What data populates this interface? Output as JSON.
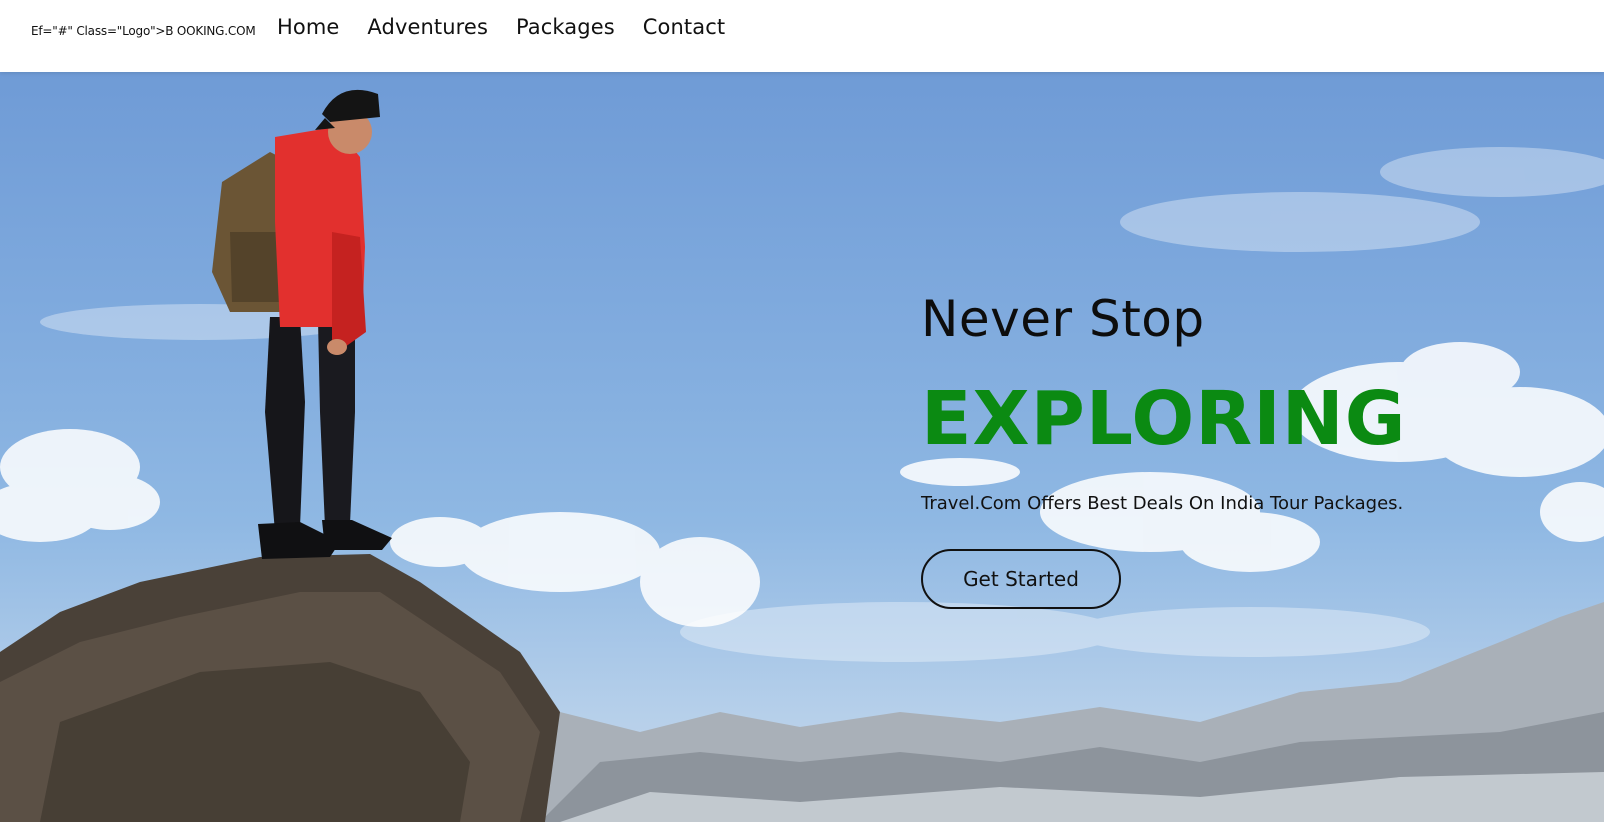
{
  "header": {
    "logo_text": "Ef=\"#\" Class=\"Logo\">B OOKING.COM",
    "nav": [
      {
        "label": "Home"
      },
      {
        "label": "Adventures"
      },
      {
        "label": "Packages"
      },
      {
        "label": "Contact"
      }
    ]
  },
  "hero": {
    "subtitle": "Never Stop",
    "title": "EXPLORING",
    "description": "Travel.Com Offers Best Deals On India Tour Packages.",
    "cta_label": "Get Started",
    "title_color": "#0b8a12",
    "background_image": "hiker-on-cliff-icon"
  }
}
